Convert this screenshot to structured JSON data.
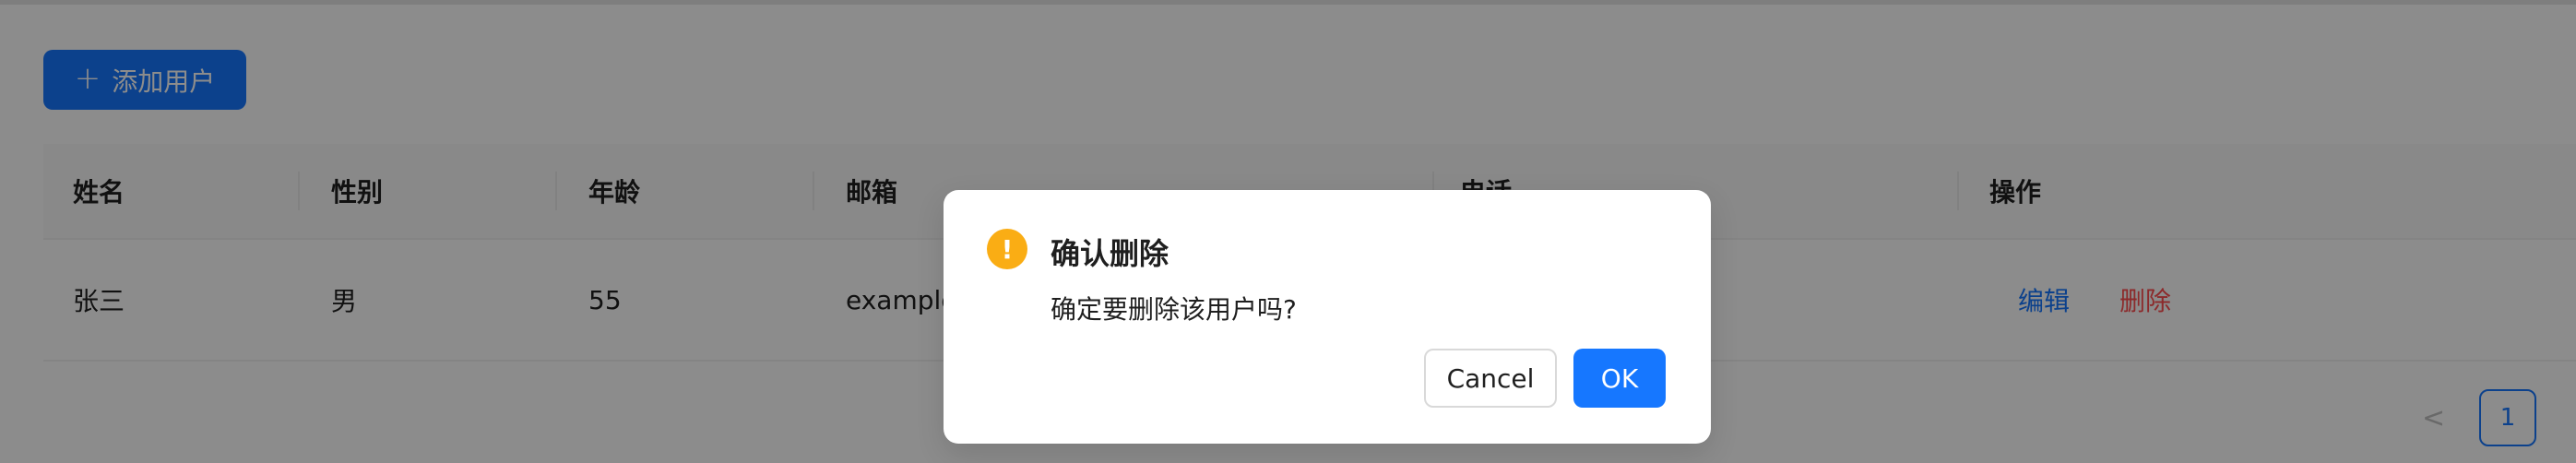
{
  "toolbar": {
    "add_label": "添加用户",
    "add_icon": "plus-icon"
  },
  "table": {
    "columns": [
      "姓名",
      "性别",
      "年龄",
      "邮箱",
      "电话",
      "操作"
    ],
    "rows": [
      {
        "name": "张三",
        "gender": "男",
        "age": "55",
        "email": "example",
        "edit_label": "编辑",
        "delete_label": "删除"
      }
    ]
  },
  "pagination": {
    "prev_icon": "chevron-left-icon",
    "current": "1"
  },
  "modal": {
    "icon": "exclamation-circle-icon",
    "icon_glyph": "!",
    "title": "确认删除",
    "content": "确定要删除该用户吗?",
    "cancel_label": "Cancel",
    "ok_label": "OK"
  },
  "colors": {
    "primary": "#1677ff",
    "danger": "#ff4d4f",
    "warning": "#faad14",
    "mask": "rgba(0,0,0,0.45)"
  }
}
